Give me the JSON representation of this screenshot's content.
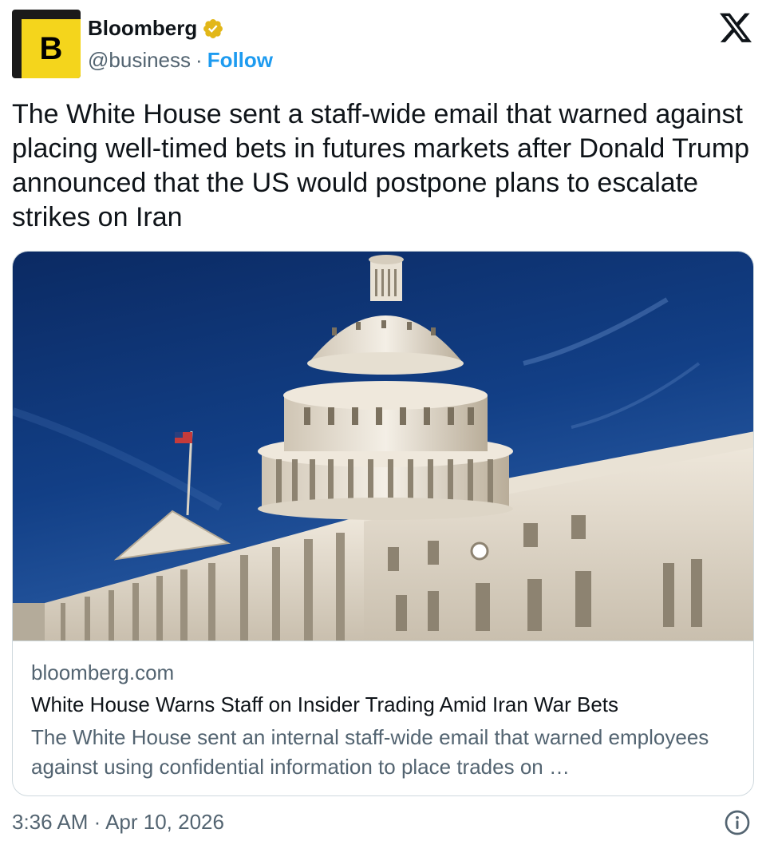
{
  "author": {
    "avatar_letter": "B",
    "name": "Bloomberg",
    "handle": "@business",
    "separator": "·",
    "follow_label": "Follow"
  },
  "icons": {
    "verified": "verified-badge-icon",
    "platform": "x-logo-icon",
    "info": "info-icon"
  },
  "colors": {
    "accent": "#1d9bf0",
    "verified_gold": "#e2b719",
    "avatar_yellow": "#f4d51c",
    "secondary_text": "#536471"
  },
  "tweet": {
    "text": "The White House sent a staff-wide email that warned against placing well-timed bets in futures markets after Donald Trump announced that the US would postpone plans to escalate strikes on Iran"
  },
  "card": {
    "domain": "bloomberg.com",
    "title": "White House Warns Staff on Insider Trading Amid Iran War Bets",
    "description": "The White House sent an internal staff-wide email that warned employees against using confidential information to place trades on …"
  },
  "footer": {
    "timestamp": "3:36 AM · Apr 10, 2026"
  }
}
